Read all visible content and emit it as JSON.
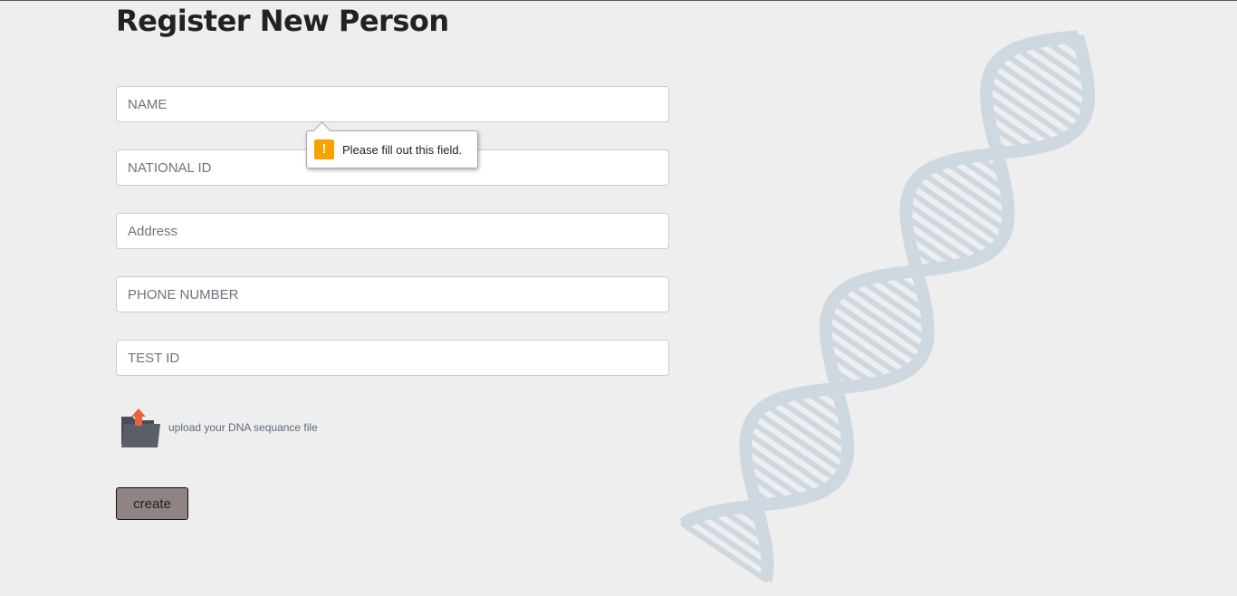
{
  "page": {
    "title": "Register New Person"
  },
  "form": {
    "fields": [
      {
        "placeholder": "NAME",
        "value": ""
      },
      {
        "placeholder": "NATIONAL ID",
        "value": ""
      },
      {
        "placeholder": "Address",
        "value": ""
      },
      {
        "placeholder": "PHONE NUMBER",
        "value": ""
      },
      {
        "placeholder": "TEST ID",
        "value": ""
      }
    ],
    "validation_tooltip": "Please fill out this field.",
    "upload_label": "upload your DNA sequance file",
    "create_label": "create"
  },
  "colors": {
    "accent": "#8f8483",
    "warning": "#f7a200",
    "dna": "#cdd8e1"
  }
}
